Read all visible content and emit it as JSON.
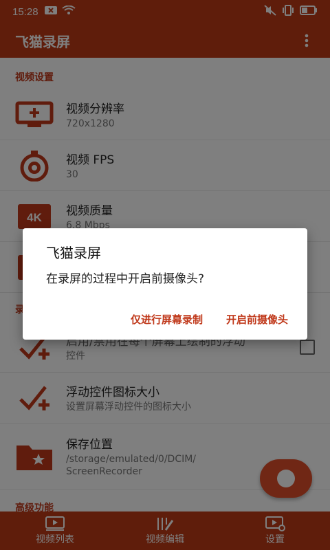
{
  "status": {
    "time": "15:28"
  },
  "app": {
    "title": "飞猫录屏"
  },
  "sections": [
    {
      "header": "视频设置"
    },
    {
      "header": "录"
    },
    {
      "header": "高级功能"
    }
  ],
  "rows": {
    "resolution": {
      "title": "视频分辨率",
      "sub": "720x1280"
    },
    "fps": {
      "title": "视频 FPS",
      "sub": "30"
    },
    "quality": {
      "title": "视频质量",
      "sub": "6.8 Mbps"
    },
    "float_enable": {
      "title": "启用/禁用在每个屏幕上绘制的浮动",
      "sub": "控件"
    },
    "float_size": {
      "title": "浮动控件图标大小",
      "sub": "设置屏幕浮动控件的图标大小"
    },
    "save_location": {
      "title": "保存位置",
      "sub": "/storage/emulated/0/DCIM/ ScreenRecorder"
    }
  },
  "bottom_nav": {
    "videos": "视频列表",
    "edit": "视频编辑",
    "settings": "设置"
  },
  "dialog": {
    "title": "飞猫录屏",
    "message": "在录屏的过程中开启前摄像头?",
    "btn_screen_only": "仅进行屏幕录制",
    "btn_camera": "开启前摄像头"
  },
  "colors": {
    "primary": "#bf3b17",
    "accent": "#c0391b",
    "fab": "#e14f2a"
  }
}
